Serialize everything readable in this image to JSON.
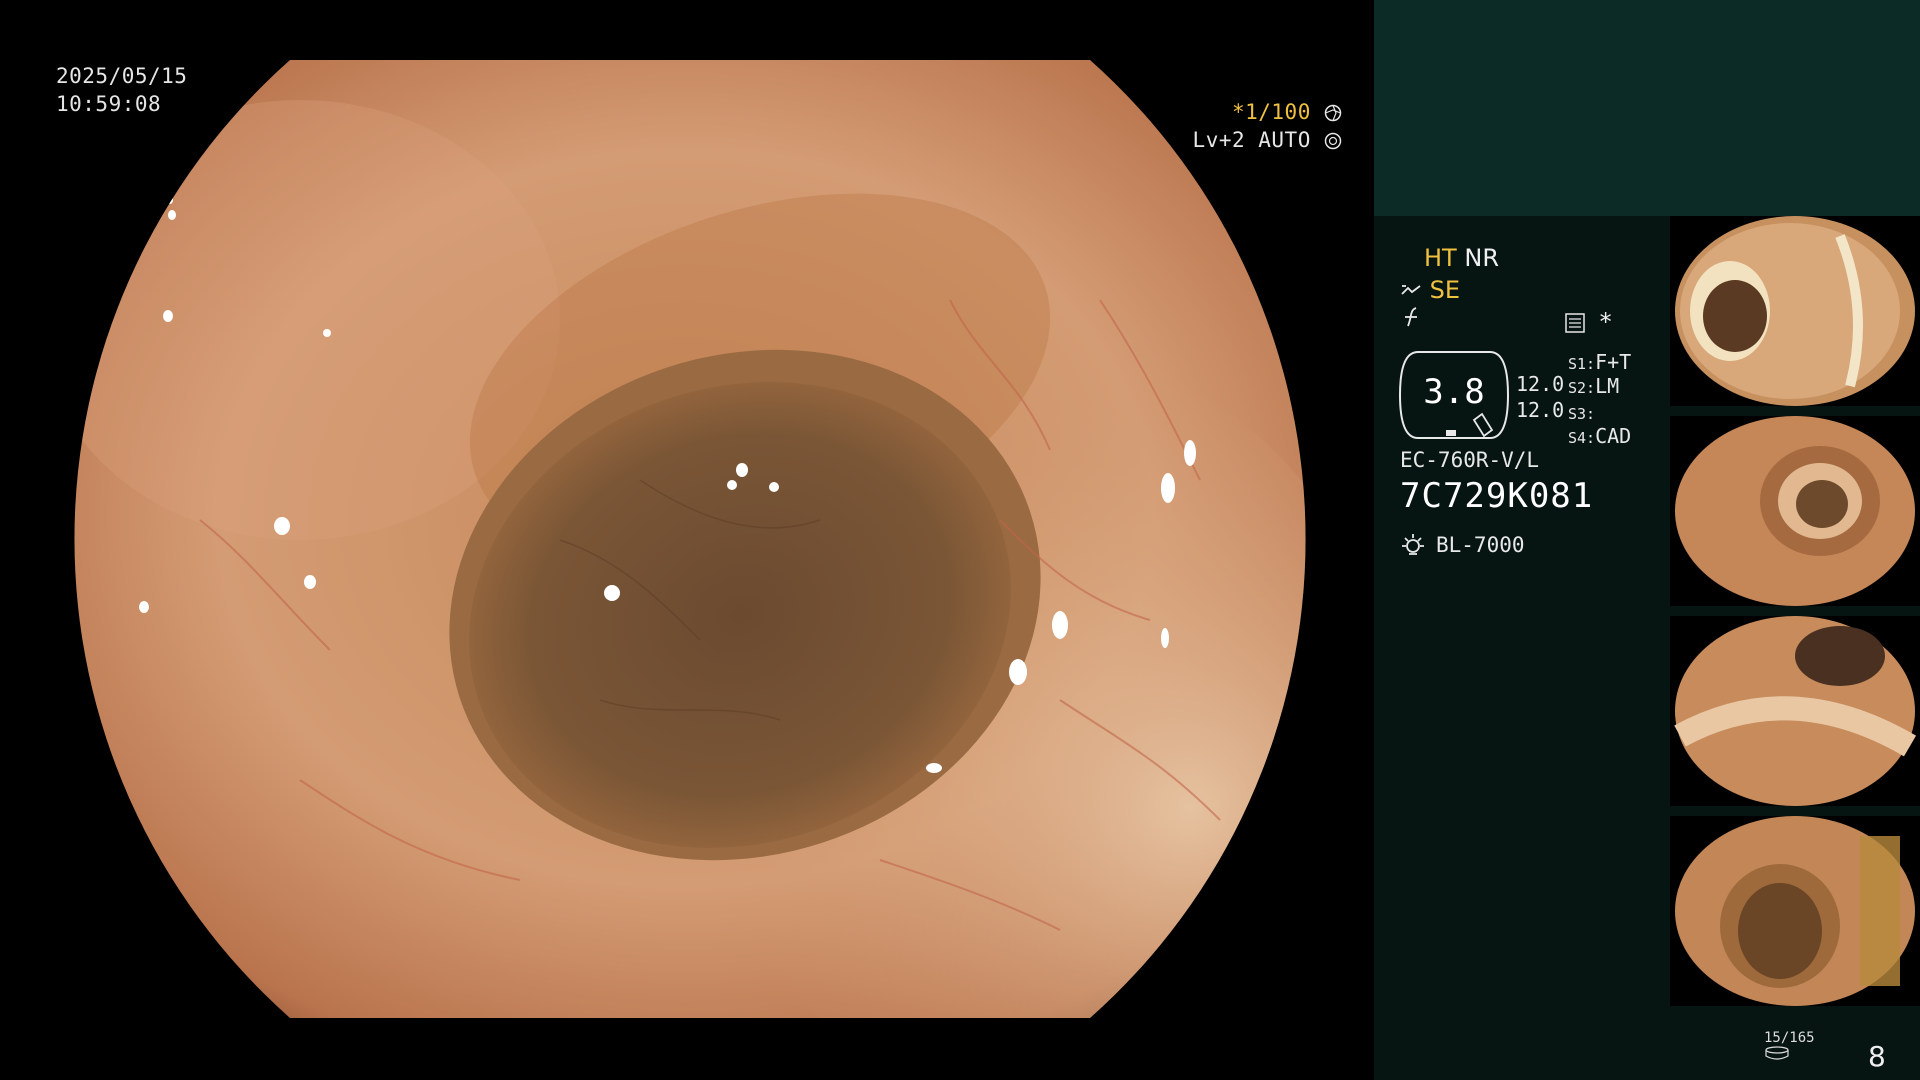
{
  "osd": {
    "date": "2025/05/15",
    "time": "10:59:08",
    "shutter_prefix": "*",
    "shutter": "1/100",
    "level": "Lv+2 AUTO"
  },
  "settings": {
    "ht": "HT",
    "nr": "NR",
    "se": "SE",
    "gauge_value": "3.8",
    "value_1": "12.0",
    "value_2": "12.0",
    "s1_key": "S1:",
    "s1_val": "F+T",
    "s2_key": "S2:",
    "s2_val": "LM",
    "s3_key": "S3:",
    "s3_val": "",
    "s4_key": "S4:",
    "s4_val": "CAD",
    "asterisk": "*"
  },
  "scope": {
    "model": "EC-760R-V/L",
    "serial": "7C729K081",
    "light_source": "BL-7000"
  },
  "footer": {
    "count": "15/165",
    "page": "8"
  },
  "icons": {
    "shutter": "aperture-icon",
    "level": "iris-icon",
    "scope": "scope-icon",
    "enhance": "enhance-icon",
    "memo": "memo-icon",
    "light": "lamp-icon",
    "storage": "disk-icon"
  },
  "colors": {
    "accent_yellow": "#f0c040",
    "panel_top": "#0d2b26",
    "panel_bg": "#071512"
  }
}
